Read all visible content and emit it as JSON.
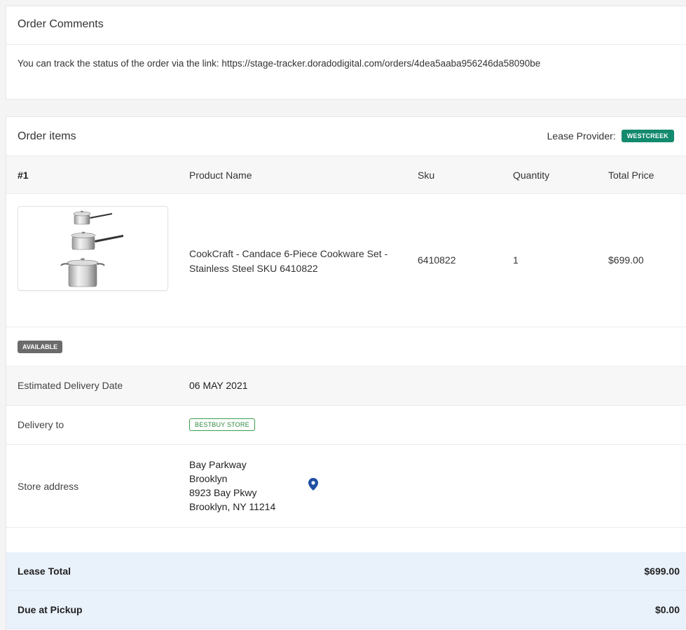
{
  "comments": {
    "title": "Order Comments",
    "text": "You can track the status of the order via the link: https://stage-tracker.doradodigital.com/orders/4dea5aaba956246da58090be"
  },
  "items": {
    "title": "Order items",
    "lease_provider_label": "Lease Provider:",
    "lease_provider_badge": "WESTCREEK",
    "columns": [
      "#1",
      "Product Name",
      "Sku",
      "Quantity",
      "Total Price"
    ],
    "product": {
      "name": "CookCraft - Candace 6-Piece Cookware Set - Stainless Steel SKU 6410822",
      "sku": "6410822",
      "quantity": "1",
      "total_price": "$699.00"
    },
    "status_badge": "AVAILABLE",
    "estimated_delivery_label": "Estimated Delivery Date",
    "estimated_delivery_value": "06 MAY 2021",
    "delivery_to_label": "Delivery to",
    "delivery_to_badge": "BESTBUY STORE",
    "store_address_label": "Store address",
    "store_address": {
      "line1": "Bay Parkway",
      "line2": "Brooklyn",
      "line3": "8923 Bay Pkwy",
      "line4": "Brooklyn, NY 11214"
    },
    "lease_total_label": "Lease Total",
    "lease_total_value": "$699.00",
    "due_at_pickup_label": "Due at Pickup",
    "due_at_pickup_value": "$0.00"
  },
  "colors": {
    "westcreek_badge": "#138a6d",
    "available_badge": "#6b6b6b",
    "store_badge": "#3aa04a",
    "pin_icon": "#1f4fa3",
    "totals_background": "#e9f1fb"
  },
  "icons": {
    "product_image": "cookware-set-image",
    "map_pin": "map-pin-icon"
  }
}
